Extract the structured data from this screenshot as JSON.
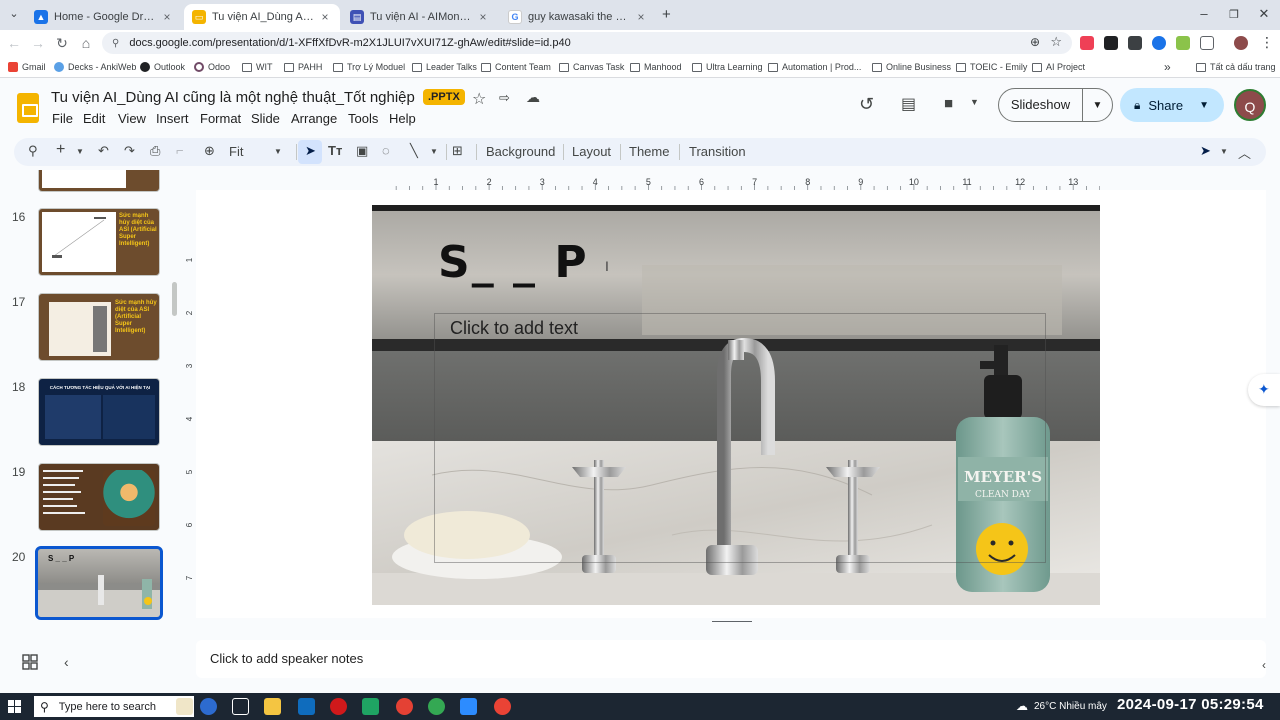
{
  "browser": {
    "tabs": [
      {
        "title": "Home - Google Drive",
        "favicon": "google-drive-icon",
        "color": "#1a73e8"
      },
      {
        "title": "Tu viện AI_Dùng AI cũng là một",
        "favicon": "google-slides-icon",
        "color": "#f4b400",
        "active": true
      },
      {
        "title": "Tu viện AI - AIMonastery (AIM)",
        "favicon": "document-icon",
        "color": "#3f51b5"
      },
      {
        "title": "guy kawasaki the art of social m",
        "favicon": "google-icon",
        "color": "#ea4335"
      }
    ],
    "url": "docs.google.com/presentation/d/1-XFffXfDvR-m2X1JLUI7vXUI71Z-ghAw/edit#slide=id.p40",
    "bookmarks": [
      {
        "label": "Gmail",
        "type": "gmail"
      },
      {
        "label": "Decks - AnkiWeb",
        "type": "site"
      },
      {
        "label": "Outlook",
        "type": "site"
      },
      {
        "label": "Odoo",
        "type": "site"
      },
      {
        "label": "WIT",
        "type": "folder"
      },
      {
        "label": "PAHH",
        "type": "folder"
      },
      {
        "label": "Trợ Lý Moduel",
        "type": "folder"
      },
      {
        "label": "Leader Talks",
        "type": "folder"
      },
      {
        "label": "Content Team",
        "type": "folder"
      },
      {
        "label": "Canvas Task",
        "type": "folder"
      },
      {
        "label": "Manhood",
        "type": "folder"
      },
      {
        "label": "Ultra Learning",
        "type": "folder"
      },
      {
        "label": "Automation | Prod...",
        "type": "folder"
      },
      {
        "label": "Online Business",
        "type": "folder"
      },
      {
        "label": "TOEIC - Emily",
        "type": "folder"
      },
      {
        "label": "AI Project",
        "type": "folder"
      }
    ],
    "bookmarks_overflow": "»",
    "all_bookmarks": "Tất cả dấu trang"
  },
  "doc": {
    "title": "Tu viện AI_Dùng AI cũng là một nghệ thuật_Tốt nghiệp",
    "badge": ".PPTX",
    "menu": [
      "File",
      "Edit",
      "View",
      "Insert",
      "Format",
      "Slide",
      "Arrange",
      "Tools",
      "Help"
    ],
    "slideshow_label": "Slideshow",
    "share_label": "Share",
    "avatar_letter": "Q"
  },
  "toolbar": {
    "zoom": "Fit",
    "background": "Background",
    "layout": "Layout",
    "theme": "Theme",
    "transition": "Transition"
  },
  "filmstrip": {
    "slides": [
      {
        "num": "16",
        "text": "Sức mạnh hủy diệt của ASI (Artificial Super Intelligent)"
      },
      {
        "num": "17",
        "text": "Sức mạnh hủy diệt của ASI (Artificial Super Intelligent)"
      },
      {
        "num": "18",
        "text": "CÁCH TƯƠNG TÁC HIỆU QUẢ VỚI AI HIỆN TẠI"
      },
      {
        "num": "19",
        "text": ""
      },
      {
        "num": "20",
        "text": "S _ _ P",
        "selected": true
      }
    ]
  },
  "ruler": [
    "1",
    "2",
    "3",
    "4",
    "5",
    "6",
    "7",
    "8",
    "9",
    "10",
    "11",
    "12",
    "13"
  ],
  "vruler": [
    "1",
    "2",
    "3",
    "4",
    "5",
    "6",
    "7"
  ],
  "slide": {
    "title": "S_ _ P",
    "placeholder": "Click to add text",
    "soap_brand": "MEYER'S",
    "soap_sub": "CLEAN DAY"
  },
  "notes_placeholder": "Click to add speaker notes",
  "taskbar": {
    "search_placeholder": "Type here to search",
    "weather": "26°C  Nhiều mây",
    "clock": "2024-09-17  05:29:54"
  }
}
